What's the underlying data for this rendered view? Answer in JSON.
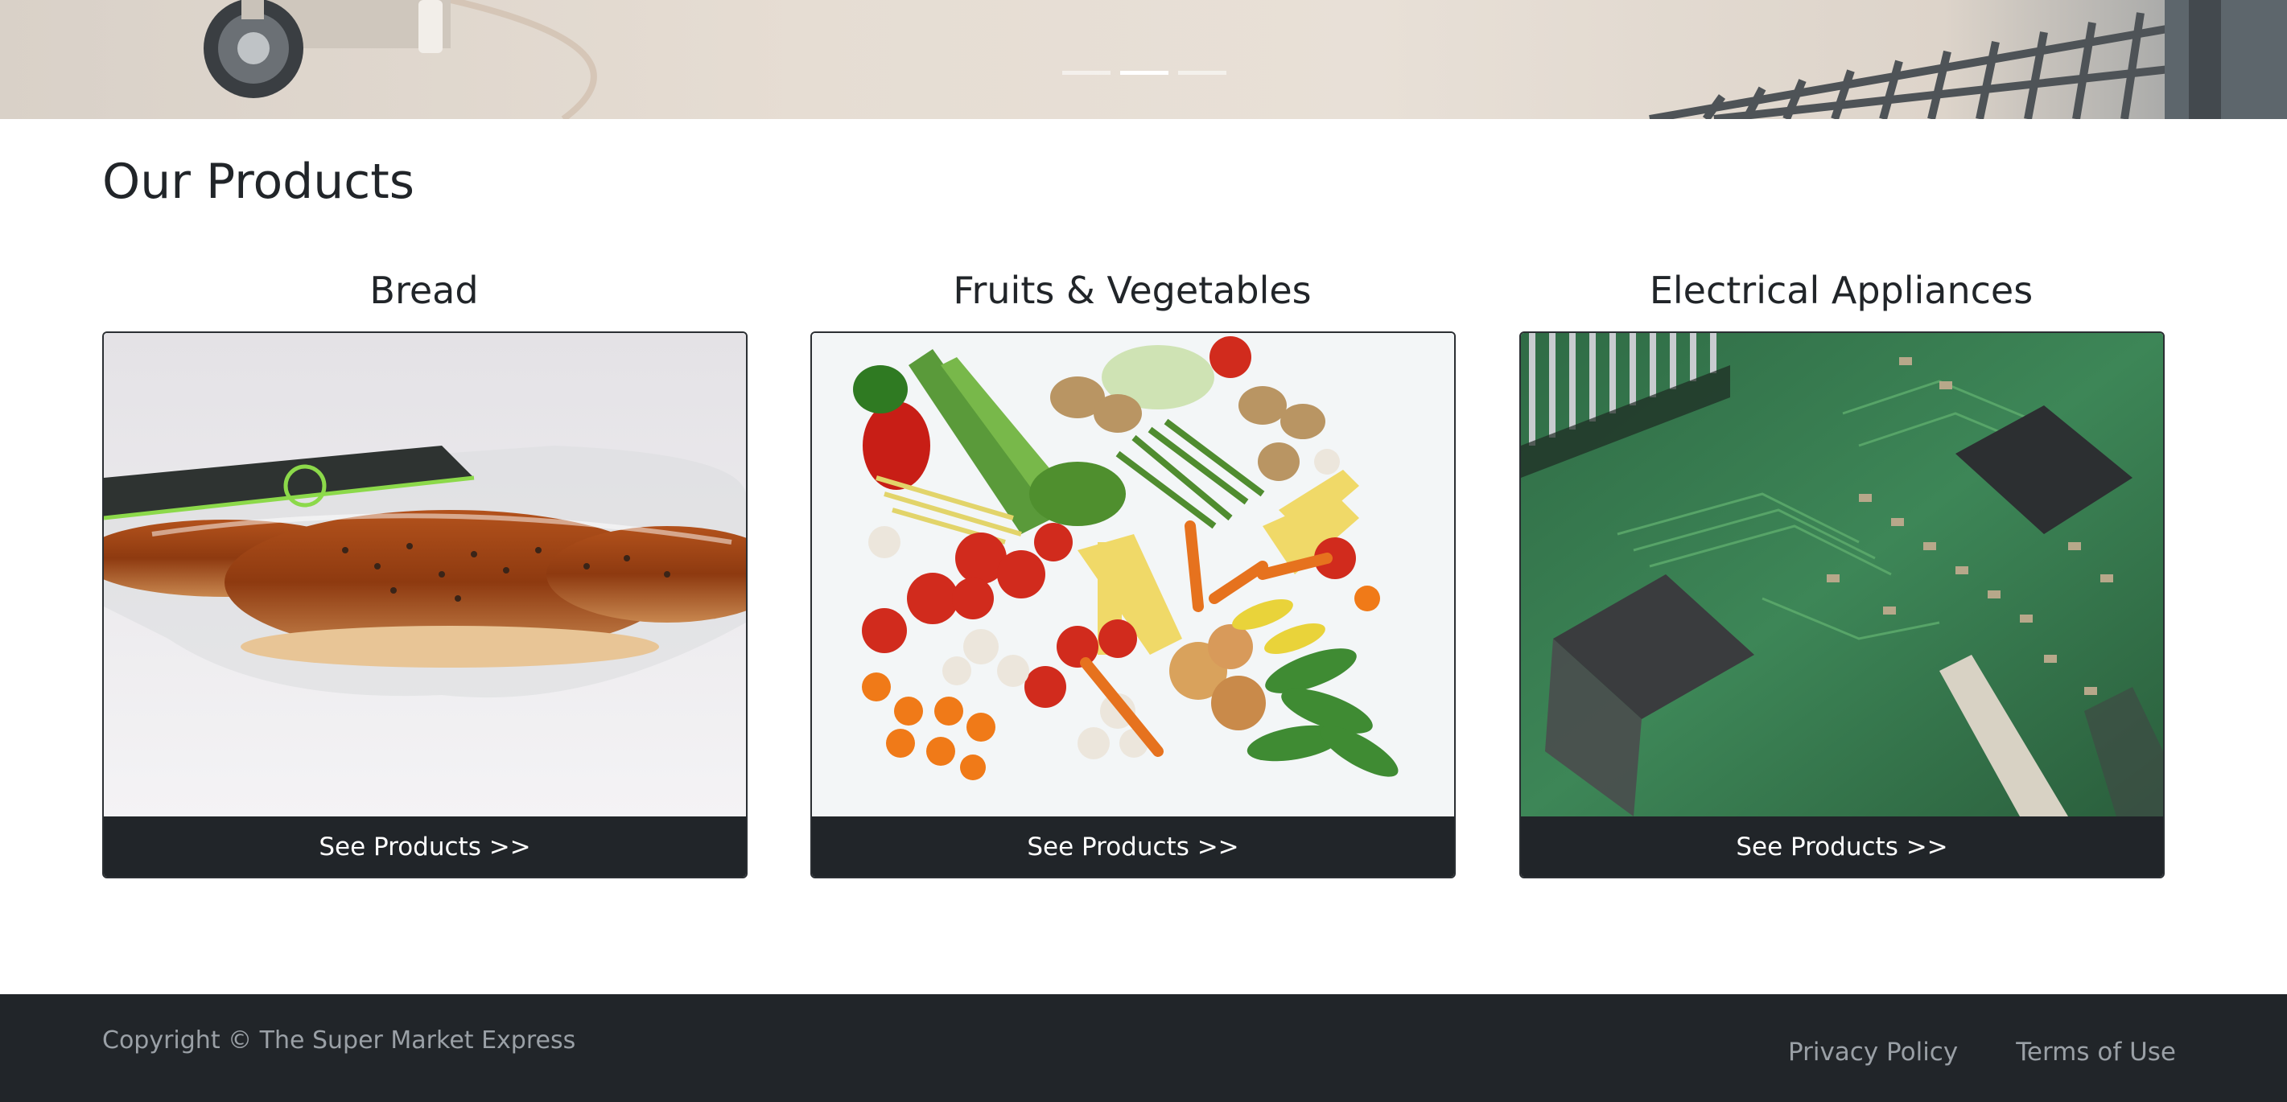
{
  "hero": {
    "slides": [
      {
        "active": false
      },
      {
        "active": true
      },
      {
        "active": false
      }
    ]
  },
  "products_section": {
    "title": "Our Products",
    "items": [
      {
        "name": "Bread",
        "button_label": "See Products >>",
        "image_icon": "bread-photo-icon"
      },
      {
        "name": "Fruits & Vegetables",
        "button_label": "See Products >>",
        "image_icon": "vegetables-photo-icon"
      },
      {
        "name": "Electrical Appliances",
        "button_label": "See Products >>",
        "image_icon": "circuit-board-photo-icon"
      }
    ]
  },
  "footer": {
    "copyright": "Copyright © The Super Market Express",
    "links": [
      "Privacy Policy",
      "Terms of Use"
    ]
  },
  "colors": {
    "dark": "#212529",
    "footer_text": "#9aa0a6",
    "page_bg": "#ffffff"
  }
}
